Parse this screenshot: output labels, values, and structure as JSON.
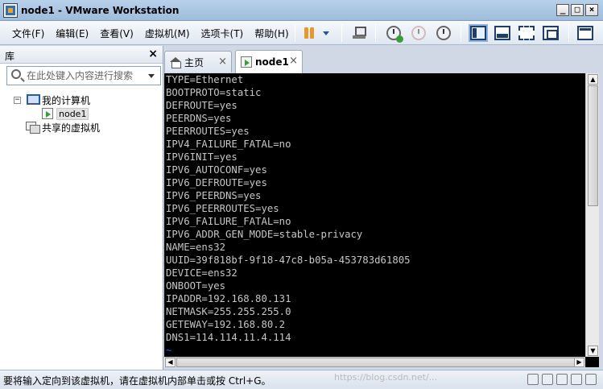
{
  "window": {
    "title": "node1 - VMware Workstation"
  },
  "menu": {
    "items": [
      {
        "label": "文件(F)"
      },
      {
        "label": "编辑(E)"
      },
      {
        "label": "查看(V)"
      },
      {
        "label": "虚拟机(M)"
      },
      {
        "label": "选项卡(T)"
      },
      {
        "label": "帮助(H)"
      }
    ]
  },
  "toolbar": {
    "icons": [
      "pause-icon",
      "dropdown-arrow-icon",
      "network-icon",
      "snapshot-take-icon",
      "snapshot-revert-icon",
      "snapshot-manager-icon",
      "library-view-icon",
      "thumbnail-bar-icon",
      "fullscreen-icon",
      "unity-icon",
      "console-view-icon"
    ]
  },
  "library": {
    "title": "库",
    "search_placeholder": "在此处键入内容进行搜索",
    "tree": {
      "my_computer": "我的计算机",
      "vm": "node1",
      "shared": "共享的虚拟机"
    }
  },
  "tabs": [
    {
      "label": "主页",
      "icon": "home-icon"
    },
    {
      "label": "node1",
      "icon": "vm-icon"
    }
  ],
  "console": {
    "lines": [
      "TYPE=Ethernet",
      "BOOTPROTO=static",
      "DEFROUTE=yes",
      "PEERDNS=yes",
      "PEERROUTES=yes",
      "IPV4_FAILURE_FATAL=no",
      "IPV6INIT=yes",
      "IPV6_AUTOCONF=yes",
      "IPV6_DEFROUTE=yes",
      "IPV6_PEERDNS=yes",
      "IPV6_PEERROUTES=yes",
      "IPV6_FAILURE_FATAL=no",
      "IPV6_ADDR_GEN_MODE=stable-privacy",
      "NAME=ens32",
      "UUID=39f818bf-9f18-47c8-b05a-453783d61805",
      "DEVICE=ens32",
      "ONBOOT=yes",
      "IPADDR=192.168.80.131",
      "NETMASK=255.255.255.0",
      "GETEWAY=192.168.80.2",
      "DNS1=114.114.11.4.114",
      "~"
    ],
    "text_color": "#c6c6c6",
    "tilde_color": "#3b5bd8",
    "background": "#000000"
  },
  "status": {
    "text": "要将输入定向到该虚拟机，请在虚拟机内部单击或按 Ctrl+G。",
    "watermark": "https://blog.csdn.net/..."
  }
}
